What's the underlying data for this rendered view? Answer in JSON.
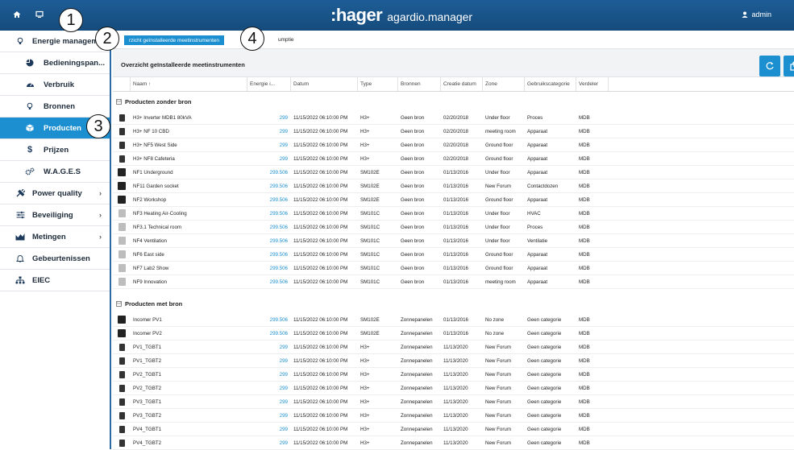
{
  "topbar": {
    "logo_hager": ":hager",
    "logo_product": "agardio.manager",
    "user": "admin"
  },
  "sidebar": {
    "items": [
      {
        "label": "Energie managem...",
        "icon": "bulb-icon",
        "level": "top"
      },
      {
        "label": "Bedieningspan...",
        "icon": "pie-chart-icon",
        "level": "sub"
      },
      {
        "label": "Verbruik",
        "icon": "gauge-icon",
        "level": "sub"
      },
      {
        "label": "Bronnen",
        "icon": "bulb-icon",
        "level": "sub"
      },
      {
        "label": "Producten",
        "icon": "cube-icon",
        "level": "sub",
        "active": true
      },
      {
        "label": "Prijzen",
        "icon": "dollar-icon",
        "level": "sub"
      },
      {
        "label": "W.A.G.E.S",
        "icon": "gears-icon",
        "level": "sub"
      },
      {
        "label": "Power quality",
        "icon": "power-plug-icon",
        "level": "top",
        "chevron": "›"
      },
      {
        "label": "Beveiliging",
        "icon": "sliders-icon",
        "level": "top",
        "chevron": "›"
      },
      {
        "label": "Metingen",
        "icon": "area-chart-icon",
        "level": "top",
        "chevron": "›"
      },
      {
        "label": "Gebeurtenissen",
        "icon": "bell-icon",
        "level": "top"
      },
      {
        "label": "EIEC",
        "icon": "sitemap-icon",
        "level": "top"
      }
    ]
  },
  "tabs": {
    "active": "rzicht geïnstalleerde meetinstrumenten",
    "second": "umptie"
  },
  "toolbar": {
    "title": "Overzicht geïnstalleerde meetinstrumenten"
  },
  "table": {
    "headers": [
      "Naam ↑",
      "Energie i...",
      "Datum",
      "Type",
      "Bronnen",
      "Creatie datum",
      "Zone",
      "Gebruikscategorie",
      "Verdeler"
    ],
    "groups": [
      {
        "title": "Producten zonder bron",
        "toggle": "⊟",
        "rows": [
          {
            "icon": "h3",
            "name": "H3+ Inverter MDB1 80kVA",
            "energy": "299",
            "date": "11/15/2022 06:10:00 PM",
            "type": "H3+",
            "src": "Geen bron",
            "cdate": "02/20/2018",
            "zone": "Under floor",
            "cat": "Proces",
            "ver": "MDB"
          },
          {
            "icon": "h3",
            "name": "H3+ NF 10 CBD",
            "energy": "299",
            "date": "11/15/2022 06:10:00 PM",
            "type": "H3+",
            "src": "Geen bron",
            "cdate": "02/20/2018",
            "zone": "meeting room",
            "cat": "Apparaat",
            "ver": "MDB"
          },
          {
            "icon": "h3",
            "name": "H3+ NF5 West Side",
            "energy": "299",
            "date": "11/15/2022 06:10:00 PM",
            "type": "H3+",
            "src": "Geen bron",
            "cdate": "02/20/2018",
            "zone": "Ground floor",
            "cat": "Apparaat",
            "ver": "MDB"
          },
          {
            "icon": "h3",
            "name": "H3+ NF8 Cafeteria",
            "energy": "299",
            "date": "11/15/2022 06:10:00 PM",
            "type": "H3+",
            "src": "Geen bron",
            "cdate": "02/20/2018",
            "zone": "Ground floor",
            "cat": "Apparaat",
            "ver": "MDB"
          },
          {
            "icon": "sm102",
            "name": "NF1 Underground",
            "energy": "299.506",
            "date": "11/15/2022 06:10:00 PM",
            "type": "SM102E",
            "src": "Geen bron",
            "cdate": "01/13/2016",
            "zone": "Under floor",
            "cat": "Apparaat",
            "ver": "MDB"
          },
          {
            "icon": "sm102",
            "name": "NF11 Garden socket",
            "energy": "299.506",
            "date": "11/15/2022 06:10:00 PM",
            "type": "SM102E",
            "src": "Geen bron",
            "cdate": "01/13/2016",
            "zone": "New Forum",
            "cat": "Contactdozen",
            "ver": "MDB"
          },
          {
            "icon": "sm102",
            "name": "NF2 Workshop",
            "energy": "299.506",
            "date": "11/15/2022 06:10:00 PM",
            "type": "SM102E",
            "src": "Geen bron",
            "cdate": "01/13/2016",
            "zone": "Ground floor",
            "cat": "Apparaat",
            "ver": "MDB"
          },
          {
            "icon": "sm101",
            "name": "NF3 Heating Air-Cooling",
            "energy": "299.506",
            "date": "11/15/2022 06:10:00 PM",
            "type": "SM101C",
            "src": "Geen bron",
            "cdate": "01/13/2016",
            "zone": "Under floor",
            "cat": "HVAC",
            "ver": "MDB"
          },
          {
            "icon": "sm101",
            "name": "NF3.1 Technical room",
            "energy": "299.506",
            "date": "11/15/2022 06:10:00 PM",
            "type": "SM101C",
            "src": "Geen bron",
            "cdate": "01/13/2016",
            "zone": "Under floor",
            "cat": "Proces",
            "ver": "MDB"
          },
          {
            "icon": "sm101",
            "name": "NF4 Ventilation",
            "energy": "299.506",
            "date": "11/15/2022 06:10:00 PM",
            "type": "SM101C",
            "src": "Geen bron",
            "cdate": "01/13/2016",
            "zone": "Under floor",
            "cat": "Ventilatie",
            "ver": "MDB"
          },
          {
            "icon": "sm101",
            "name": "NF6 East side",
            "energy": "299.506",
            "date": "11/15/2022 06:10:00 PM",
            "type": "SM101C",
            "src": "Geen bron",
            "cdate": "01/13/2016",
            "zone": "Ground floor",
            "cat": "Apparaat",
            "ver": "MDB"
          },
          {
            "icon": "sm101",
            "name": "NF7 Lab2 Show",
            "energy": "299.506",
            "date": "11/15/2022 06:10:00 PM",
            "type": "SM101C",
            "src": "Geen bron",
            "cdate": "01/13/2016",
            "zone": "Ground floor",
            "cat": "Apparaat",
            "ver": "MDB"
          },
          {
            "icon": "sm101",
            "name": "NF9 Innovation",
            "energy": "299.506",
            "date": "11/15/2022 06:10:00 PM",
            "type": "SM101C",
            "src": "Geen bron",
            "cdate": "01/13/2016",
            "zone": "meeting room",
            "cat": "Apparaat",
            "ver": "MDB"
          }
        ]
      },
      {
        "title": "Producten met bron",
        "toggle": "⊟",
        "rows": [
          {
            "icon": "sm102",
            "name": "Incomer PV1",
            "energy": "299.506",
            "date": "11/15/2022 06:10:00 PM",
            "type": "SM102E",
            "src": "Zonnepanelen",
            "cdate": "01/13/2016",
            "zone": "No zone",
            "cat": "Geen categorie",
            "ver": "MDB"
          },
          {
            "icon": "sm102",
            "name": "Incomer PV2",
            "energy": "299.506",
            "date": "11/15/2022 06:10:00 PM",
            "type": "SM102E",
            "src": "Zonnepanelen",
            "cdate": "01/13/2016",
            "zone": "No zone",
            "cat": "Geen categorie",
            "ver": "MDB"
          },
          {
            "icon": "h3",
            "name": "PV1_TGBT1",
            "energy": "299",
            "date": "11/15/2022 06:10:00 PM",
            "type": "H3+",
            "src": "Zonnepanelen",
            "cdate": "11/13/2020",
            "zone": "New Forum",
            "cat": "Geen categorie",
            "ver": "MDB"
          },
          {
            "icon": "h3",
            "name": "PV1_TGBT2",
            "energy": "299",
            "date": "11/15/2022 06:10:00 PM",
            "type": "H3+",
            "src": "Zonnepanelen",
            "cdate": "11/13/2020",
            "zone": "New Forum",
            "cat": "Geen categorie",
            "ver": "MDB"
          },
          {
            "icon": "h3",
            "name": "PV2_TGBT1",
            "energy": "299",
            "date": "11/15/2022 06:10:00 PM",
            "type": "H3+",
            "src": "Zonnepanelen",
            "cdate": "11/13/2020",
            "zone": "New Forum",
            "cat": "Geen categorie",
            "ver": "MDB"
          },
          {
            "icon": "h3",
            "name": "PV2_TGBT2",
            "energy": "299",
            "date": "11/15/2022 06:10:00 PM",
            "type": "H3+",
            "src": "Zonnepanelen",
            "cdate": "11/13/2020",
            "zone": "New Forum",
            "cat": "Geen categorie",
            "ver": "MDB"
          },
          {
            "icon": "h3",
            "name": "PV3_TGBT1",
            "energy": "299",
            "date": "11/15/2022 06:10:00 PM",
            "type": "H3+",
            "src": "Zonnepanelen",
            "cdate": "11/13/2020",
            "zone": "New Forum",
            "cat": "Geen categorie",
            "ver": "MDB"
          },
          {
            "icon": "h3",
            "name": "PV3_TGBT2",
            "energy": "299",
            "date": "11/15/2022 06:10:00 PM",
            "type": "H3+",
            "src": "Zonnepanelen",
            "cdate": "11/13/2020",
            "zone": "New Forum",
            "cat": "Geen categorie",
            "ver": "MDB"
          },
          {
            "icon": "h3",
            "name": "PV4_TGBT1",
            "energy": "299",
            "date": "11/15/2022 06:10:00 PM",
            "type": "H3+",
            "src": "Zonnepanelen",
            "cdate": "11/13/2020",
            "zone": "New Forum",
            "cat": "Geen categorie",
            "ver": "MDB"
          },
          {
            "icon": "h3",
            "name": "PV4_TGBT2",
            "energy": "299",
            "date": "11/15/2022 06:10:00 PM",
            "type": "H3+",
            "src": "Zonnepanelen",
            "cdate": "11/13/2020",
            "zone": "New Forum",
            "cat": "Geen categorie",
            "ver": "MDB"
          }
        ]
      }
    ]
  },
  "callouts": [
    "1",
    "2",
    "3",
    "4"
  ]
}
